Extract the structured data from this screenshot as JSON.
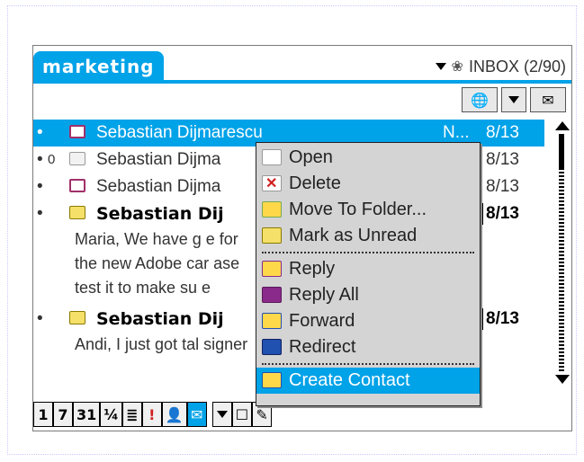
{
  "header": {
    "category": "marketing",
    "folder": "INBOX (2/90)"
  },
  "messages": [
    {
      "bullet": "•",
      "attachment": "",
      "icon": "forwarded-mail-icon",
      "sender": "Sebastian Dijmarescu",
      "flag": "N...",
      "date": "8/13",
      "selected": true,
      "bold": false,
      "preview": []
    },
    {
      "bullet": "•",
      "attachment": "0",
      "icon": "read-mail-icon",
      "sender": "Sebastian Dijma",
      "flag": "",
      "date": "8/13",
      "selected": false,
      "bold": false,
      "preview": []
    },
    {
      "bullet": "•",
      "attachment": "",
      "icon": "forwarded-mail-icon",
      "sender": "Sebastian Dijma",
      "flag": "",
      "date": "8/13",
      "selected": false,
      "bold": false,
      "preview": []
    },
    {
      "bullet": "•",
      "attachment": "",
      "icon": "unread-mail-icon",
      "sender": "Sebastian Dij",
      "flag": "",
      "date": "8/13",
      "selected": false,
      "bold": true,
      "preview": [
        "Maria,  We have g                              e for",
        "the new Adobe car                              ase",
        "test it to make su                               e"
      ]
    },
    {
      "bullet": "•",
      "attachment": "",
      "icon": "unread-mail-icon",
      "sender": "Sebastian Dij",
      "flag": "",
      "date": "8/13",
      "selected": false,
      "bold": true,
      "preview": [
        "Andi,  I just got tal                            signer"
      ]
    }
  ],
  "bottom_bar": {
    "buttons": [
      "1",
      "7",
      "31",
      "¼",
      "≣",
      "!",
      "",
      ""
    ]
  },
  "context_menu": {
    "items": [
      {
        "label": "Open",
        "icon": "open-envelope-icon"
      },
      {
        "label": "Delete",
        "icon": "delete-x-icon"
      },
      {
        "label": "Move To Folder...",
        "icon": "move-folder-icon"
      },
      {
        "label": "Mark as Unread",
        "icon": "unread-envelope-icon"
      },
      {
        "label": "Reply",
        "icon": "reply-icon"
      },
      {
        "label": "Reply All",
        "icon": "reply-all-icon"
      },
      {
        "label": "Forward",
        "icon": "forward-icon"
      },
      {
        "label": "Redirect",
        "icon": "redirect-icon"
      },
      {
        "label": "Create Contact",
        "icon": "contact-icon"
      }
    ]
  },
  "colors": {
    "accent": "#00a2e8",
    "menu_bg": "#d4d4d4"
  }
}
